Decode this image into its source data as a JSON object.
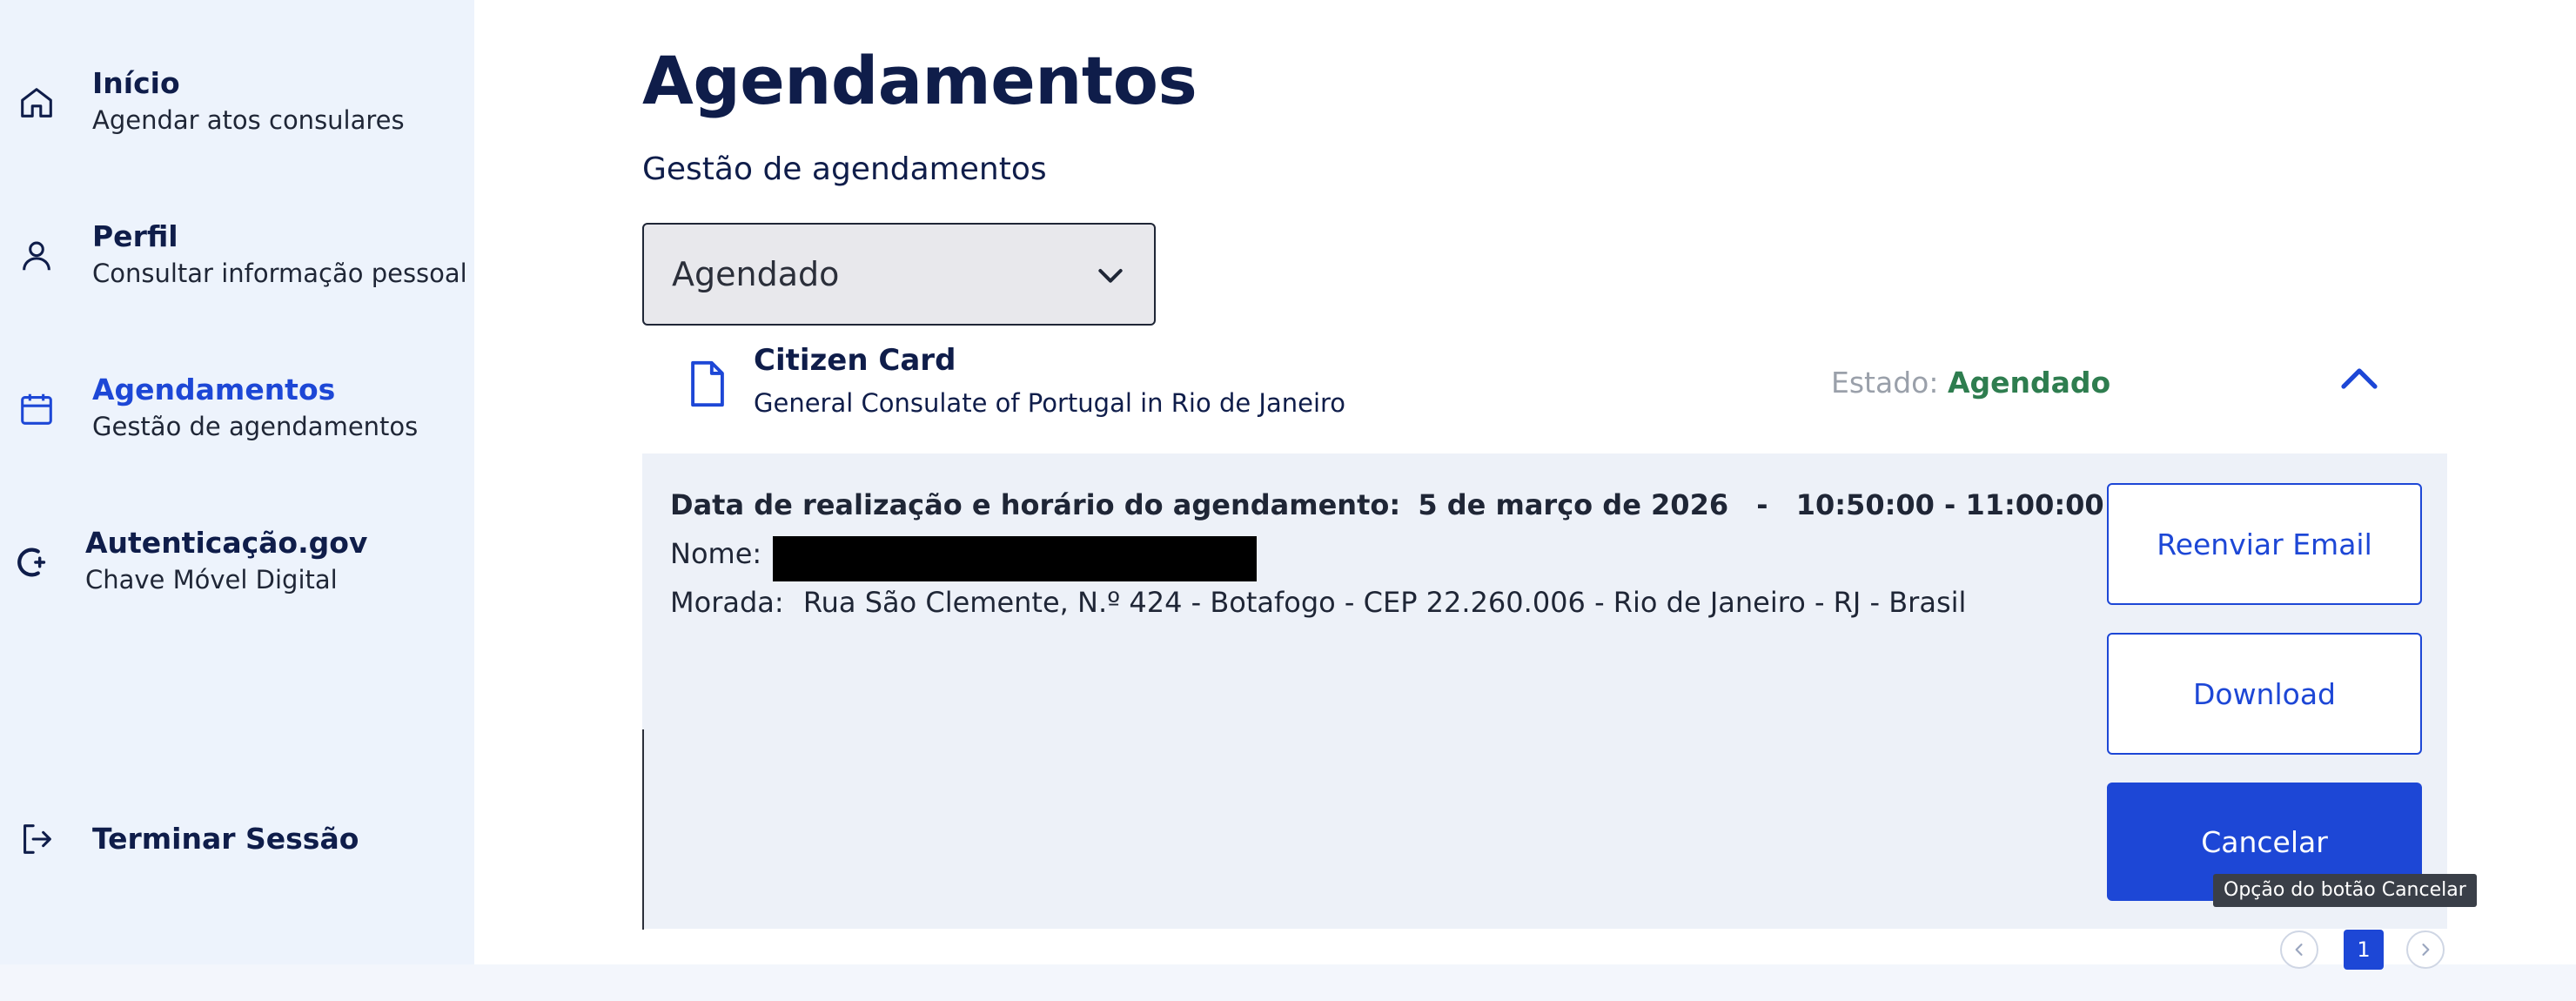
{
  "sidebar": {
    "items": [
      {
        "title": "Início",
        "subtitle": "Agendar atos consulares",
        "icon": "home-icon"
      },
      {
        "title": "Perfil",
        "subtitle": "Consultar informação pessoal",
        "icon": "user-icon"
      },
      {
        "title": "Agendamentos",
        "subtitle": "Gestão de agendamentos",
        "icon": "calendar-icon",
        "active": true
      },
      {
        "title": "Autenticação.gov",
        "subtitle": "Chave Móvel Digital",
        "icon": "autenticacao-gov-icon"
      }
    ],
    "logout": {
      "label": "Terminar Sessão",
      "icon": "logout-icon"
    }
  },
  "main": {
    "title": "Agendamentos",
    "subtitle": "Gestão de agendamentos",
    "filter": {
      "selected": "Agendado"
    },
    "appointment": {
      "service": "Citizen Card",
      "location": "General Consulate of Portugal in Rio de Janeiro",
      "status_label": "Estado:",
      "status_value": "Agendado",
      "date_label": "Data de realização e horário do agendamento:",
      "date_value": "5 de março de 2026",
      "date_separator": "-",
      "time_value": "10:50:00 - 11:00:00",
      "name_label": "Nome:",
      "address_label": "Morada:",
      "address_value": "Rua São Clemente, N.º 424 - Botafogo - CEP 22.260.006 - Rio de Janeiro - RJ - Brasil"
    },
    "actions": {
      "resend": "Reenviar Email",
      "download": "Download",
      "cancel": "Cancelar"
    },
    "tooltip": "Opção do botão Cancelar",
    "pagination": {
      "current_page": "1"
    }
  },
  "colors": {
    "accent": "#1d47d6",
    "status_green": "#2e7d4f",
    "sidebar_bg": "#edf3fc",
    "panel_bg": "#edf1f8",
    "text_dark": "#0f1d4a"
  }
}
